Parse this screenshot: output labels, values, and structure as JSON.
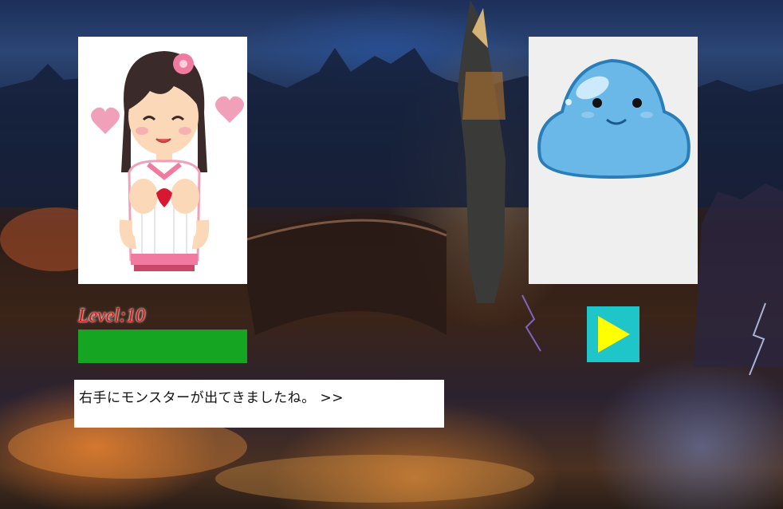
{
  "scene": {
    "name": "ruined-city-battle-scene",
    "background_colors": {
      "sky": "#2b4575",
      "ground": "#3b2418",
      "fire": "#e07830"
    }
  },
  "player": {
    "portrait": "girl-character",
    "level_text": "Level:10",
    "hp_fraction": 1.0,
    "hp_color": "#16a523"
  },
  "enemy": {
    "portrait": "blue-slime-monster"
  },
  "controls": {
    "next_icon": "play-triangle-icon",
    "next_color": "#1ec5c9",
    "next_icon_color": "#ffff00"
  },
  "dialog": {
    "text": "右手にモンスターが出てきましたね。 >>"
  }
}
